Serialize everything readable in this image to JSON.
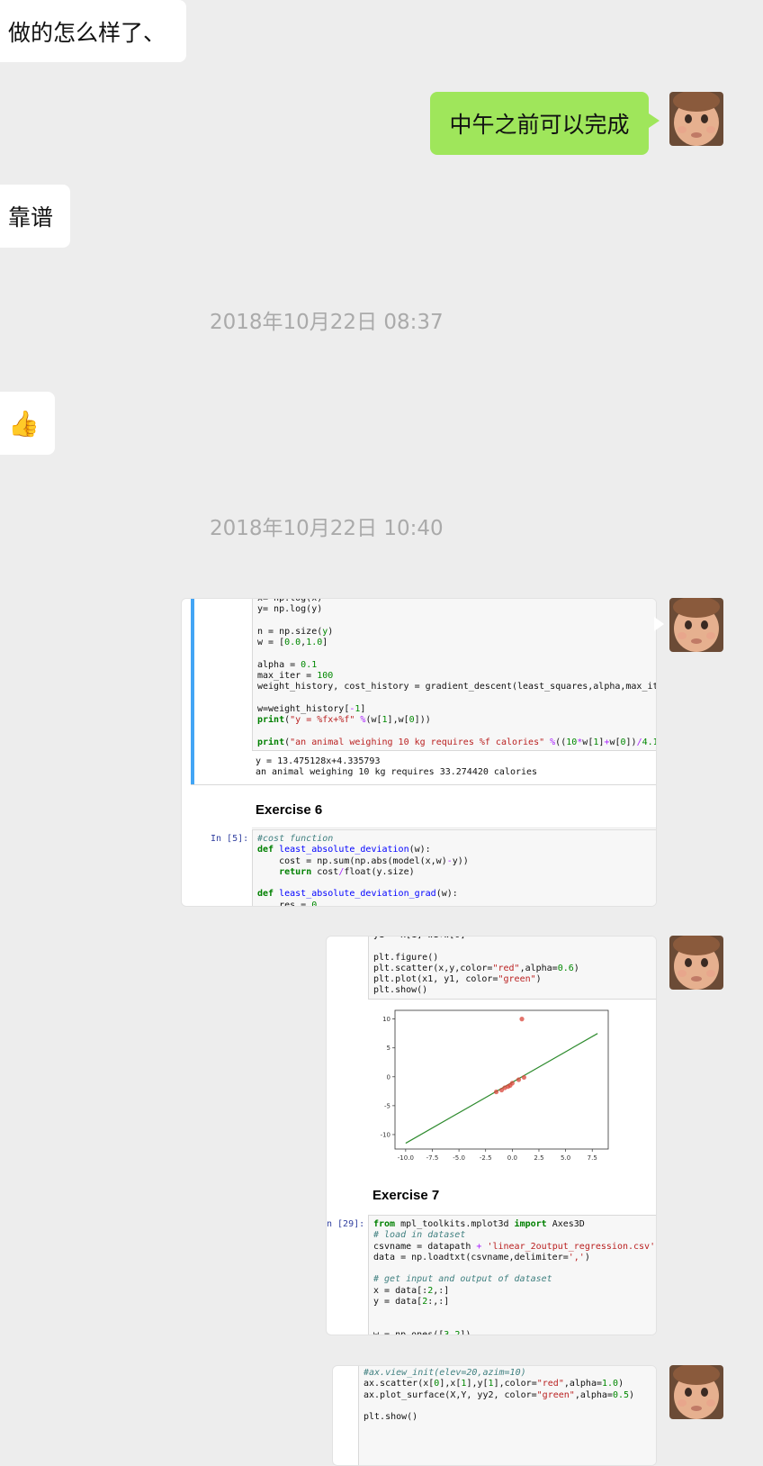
{
  "messages": {
    "m1_text": "做的怎么样了、",
    "m2_text": "中午之前可以完成",
    "m3_text": "靠谱",
    "ts1": "2018年10月22日 08:37",
    "m4_emoji": "👍",
    "ts2": "2018年10月22日 10:40"
  },
  "shot1": {
    "exercise_heading": "Exercise 6",
    "prompt": "In [5]:",
    "output_line1": "y = 13.475128x+4.335793",
    "output_line2": "an animal weighing 10 kg requires 33.274420 calories"
  },
  "shot2": {
    "exercise_heading": "Exercise 7",
    "prompt": "n [29]:"
  },
  "chart_data": {
    "type": "scatter",
    "xlim": [
      -11,
      9
    ],
    "ylim": [
      -12.5,
      11.5
    ],
    "xticks": [
      "-10.0",
      "-7.5",
      "-5.0",
      "-2.5",
      "0.0",
      "2.5",
      "5.0",
      "7.5"
    ],
    "yticks": [
      "10",
      "5",
      "0",
      "-5",
      "-10"
    ],
    "points": [
      [
        -1.5,
        -2.6
      ],
      [
        -1.0,
        -2.3
      ],
      [
        -0.7,
        -1.9
      ],
      [
        -0.4,
        -1.7
      ],
      [
        -0.2,
        -1.5
      ],
      [
        0.0,
        -1.1
      ],
      [
        0.6,
        -0.5
      ],
      [
        1.1,
        -0.1
      ],
      [
        0.9,
        10.0
      ]
    ],
    "line": [
      [
        -10.0,
        -11.5
      ],
      [
        8.0,
        7.5
      ]
    ],
    "colors": {
      "scatter": "#d9463b",
      "line": "#2e8b2e"
    },
    "grid": false
  }
}
